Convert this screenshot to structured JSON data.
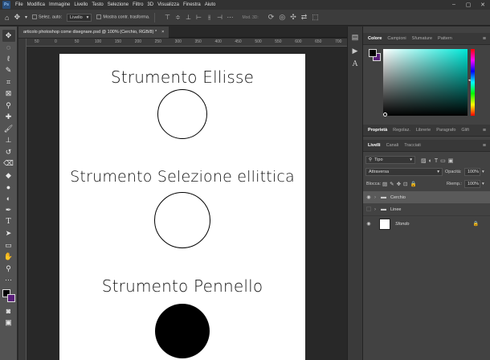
{
  "app": {
    "logo": "Ps",
    "menu": [
      "File",
      "Modifica",
      "Immagine",
      "Livello",
      "Testo",
      "Selezione",
      "Filtro",
      "3D",
      "Visualizza",
      "Finestra",
      "Aiuto"
    ]
  },
  "options_bar": {
    "auto_select_label": "Selez. auto:",
    "auto_select_target": "Livello",
    "show_transform_label": "Mostra contr. trasforma.",
    "mode_3d_label": "Mod. 3D:"
  },
  "document": {
    "tab_title": "articolo photoshop come disegnare.psd @ 100% (Cerchio, RGB/8) *",
    "tab_close": "×",
    "ruler_ticks": [
      "50",
      "0",
      "50",
      "100",
      "150",
      "200",
      "250",
      "300",
      "350",
      "400",
      "450",
      "500",
      "550",
      "600",
      "650",
      "700"
    ],
    "sections": [
      {
        "title": "Strumento Ellisse",
        "circle_style": "outline"
      },
      {
        "title": "Strumento Selezione ellittica",
        "circle_style": "outline"
      },
      {
        "title": "Strumento Pennello",
        "circle_style": "filled"
      }
    ]
  },
  "color_panel": {
    "tabs": [
      "Colore",
      "Campioni",
      "Sfumature",
      "Pattern"
    ],
    "foreground": "#000000",
    "background": "#5a1e7a",
    "picker_hue": "#00e8d8"
  },
  "properties_panel": {
    "tabs": [
      "Proprietà",
      "Regolaz.",
      "Librerie",
      "Paragrafo",
      "Glifi"
    ]
  },
  "layers_panel": {
    "tabs": [
      "Livelli",
      "Canali",
      "Tracciati"
    ],
    "filter_label": "Tipo",
    "blend_mode": "Attraversa",
    "opacity_label": "Opacità:",
    "opacity_value": "100%",
    "lock_label": "Blocca:",
    "fill_label": "Riemp.:",
    "fill_value": "100%",
    "layers": [
      {
        "name": "Cerchio",
        "type": "group",
        "visible": true,
        "selected": true
      },
      {
        "name": "Linee",
        "type": "group",
        "visible": false,
        "selected": false
      },
      {
        "name": "Sfondo",
        "type": "background",
        "visible": true,
        "selected": false
      }
    ]
  }
}
